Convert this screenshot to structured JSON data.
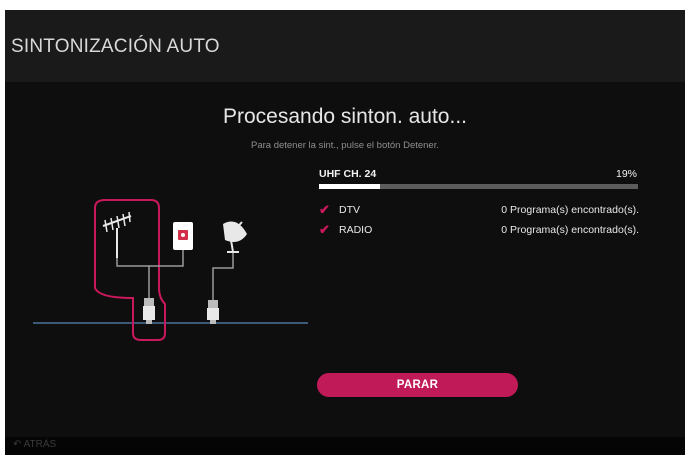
{
  "header": {
    "title": "SINTONIZACIÓN AUTO"
  },
  "status": {
    "heading": "Procesando sinton. auto...",
    "hint": "Para detener la sint., pulse el botón Detener."
  },
  "scan": {
    "channel": "UHF CH. 24",
    "percent_text": "19%",
    "progress_fraction": 0.19
  },
  "results": [
    {
      "service": "DTV",
      "count": "0  Programa(s) encontrado(s)."
    },
    {
      "service": "RADIO",
      "count": "0  Programa(s) encontrado(s)."
    }
  ],
  "actions": {
    "stop_label": "PARAR"
  },
  "footer": {
    "back_label": "ATRÁS"
  },
  "icons": [
    "antenna-icon",
    "wall-socket-icon",
    "satellite-dish-icon",
    "connector-icon",
    "check-icon",
    "back-arrow-icon"
  ],
  "colors": {
    "accent": "#c11a59",
    "background": "#0e0e0e",
    "progress": "#ffffff"
  }
}
